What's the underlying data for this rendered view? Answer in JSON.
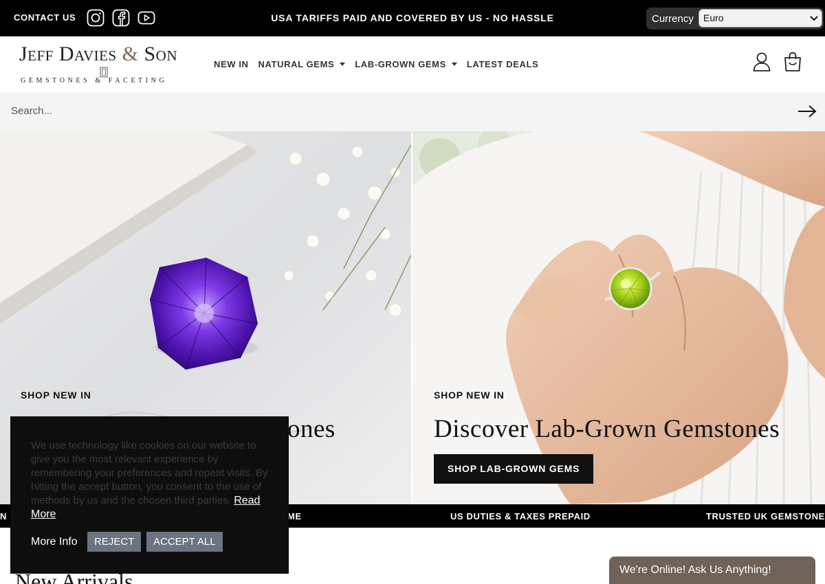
{
  "topbar": {
    "contact_label": "CONTACT US",
    "social_icons": [
      "instagram-icon",
      "facebook-icon",
      "youtube-icon"
    ],
    "announcement": "USA TARIFFS PAID AND COVERED BY US - NO HASSLE",
    "currency_label": "Currency",
    "currency_value": "Euro"
  },
  "header": {
    "logo_text_1": "Jeff Davies",
    "logo_amp": "&",
    "logo_text_2": "Son",
    "logo_sub": "GEMSTONES & FACETING",
    "nav": [
      {
        "label": "NEW IN",
        "dropdown": false
      },
      {
        "label": "NATURAL GEMS",
        "dropdown": true
      },
      {
        "label": "LAB-GROWN GEMS",
        "dropdown": true
      },
      {
        "label": "LATEST DEALS",
        "dropdown": false
      }
    ],
    "icons": [
      "account-icon",
      "cart-icon"
    ]
  },
  "search": {
    "placeholder": "Search..."
  },
  "hero": {
    "left": {
      "kicker": "SHOP NEW IN",
      "title_visible_end": "ones"
    },
    "right": {
      "kicker": "SHOP NEW IN",
      "title": "Discover Lab-Grown Gemstones",
      "button": "SHOP LAB-GROWN GEMS"
    }
  },
  "ticker": {
    "items": [
      "N",
      "ME",
      "US DUTIES & TAXES PREPAID",
      "TRUSTED UK GEMSTONE S"
    ]
  },
  "cookie": {
    "text": "We use technology like cookies on our website to give you the most relevant experience by remembering your preferences and repeat visits. By hitting the accept button, you consent to the use of methods by us and the chosen third parties.",
    "read_more": "Read More",
    "more_info": "More Info",
    "reject": "REJECT",
    "accept": "ACCEPT ALL"
  },
  "new_arrivals": "New Arrivals",
  "chat": {
    "label": "We're Online! Ask Us Anything!"
  },
  "colors": {
    "black": "#000000",
    "chat_brown": "#6e6259",
    "button_grey": "#6b7480",
    "amethyst": "#6a2fd0",
    "peridot": "#a7d21c"
  }
}
